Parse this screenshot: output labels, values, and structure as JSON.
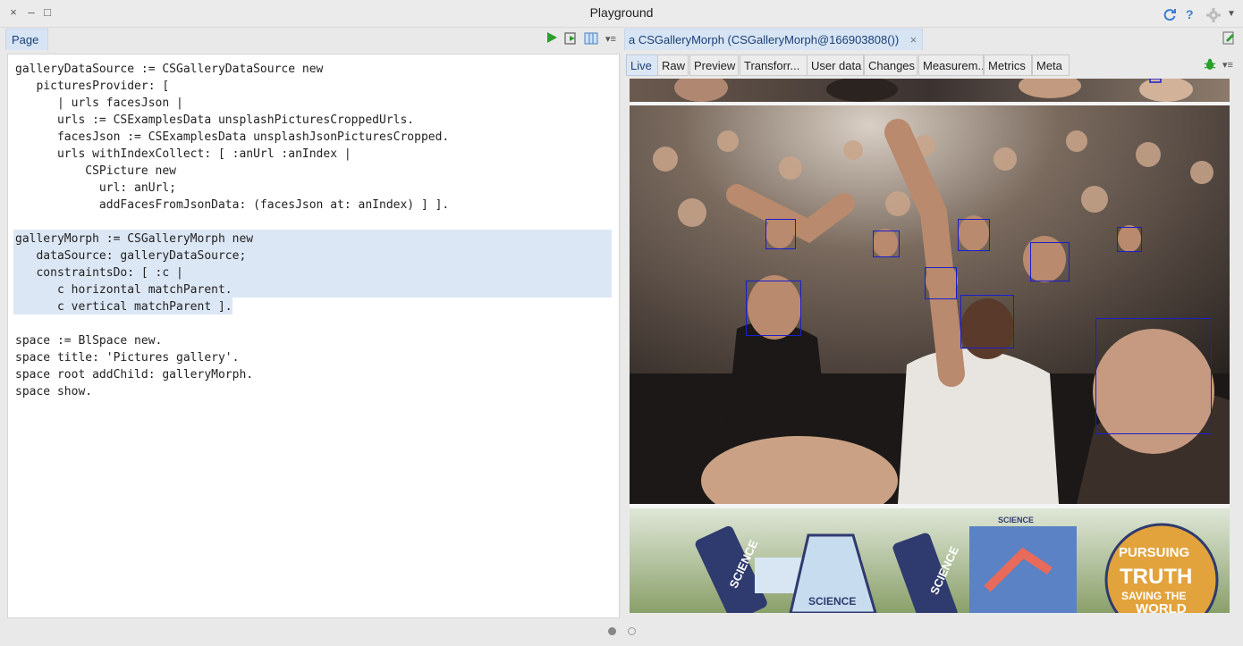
{
  "window": {
    "title": "Playground",
    "controls": {
      "close": "×",
      "minimize": "–",
      "maximize": "□"
    },
    "icons": [
      "refresh-icon",
      "help-icon",
      "gear-icon"
    ],
    "help_glyph": "?"
  },
  "left": {
    "tab_label": "Page",
    "tools": [
      "play-icon",
      "play-inspect-icon",
      "columns-icon",
      "menu-icon"
    ]
  },
  "code": {
    "lines": [
      "galleryDataSource := CSGalleryDataSource new",
      "   picturesProvider: [",
      "      | urls facesJson |",
      "      urls := CSExamplesData unsplashPicturesCroppedUrls.",
      "      facesJson := CSExamplesData unsplashJsonPicturesCropped.",
      "      urls withIndexCollect: [ :anUrl :anIndex |",
      "          CSPicture new",
      "            url: anUrl;",
      "            addFacesFromJsonData: (facesJson at: anIndex) ] ].",
      "",
      "galleryMorph := CSGalleryMorph new",
      "   dataSource: galleryDataSource;",
      "   constraintsDo: [ :c |",
      "      c horizontal matchParent.",
      "      c vertical matchParent ].",
      "",
      "space := BlSpace new.",
      "space title: 'Pictures gallery'.",
      "space root addChild: galleryMorph.",
      "space show."
    ]
  },
  "right": {
    "object_tab_label": "a CSGalleryMorph (CSGalleryMorph@166903808())",
    "object_tab_close": "×",
    "subtabs": [
      "Live",
      "Raw",
      "Preview",
      "Transforr...",
      "User data",
      "Changes",
      "Measurem...",
      "Metrics",
      "Meta"
    ],
    "active_subtab": "Live",
    "tools": [
      "bug-icon",
      "menu-icon"
    ]
  },
  "pager": {
    "pages": 2,
    "current": 1
  },
  "colors": {
    "accent": "#1c3f76",
    "selection": "#dce7f5",
    "face_box": "#1a1ecc",
    "play_green": "#2aa02a"
  },
  "sticker_texts": [
    "SCIENCE",
    "SCIENCE",
    "SCIENCE",
    "SCIENCE",
    "PURSUING",
    "TRUTH",
    "SAVING THE",
    "WORLD"
  ]
}
